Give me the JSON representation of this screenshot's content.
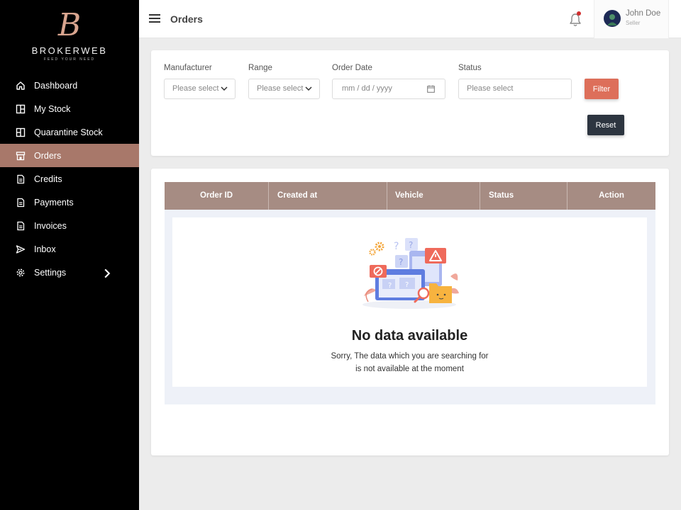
{
  "brand": {
    "mark": "B",
    "name": "BROKERWEB",
    "tagline": "FEED YOUR NEED"
  },
  "sidebar": {
    "items": [
      {
        "label": "Dashboard",
        "icon": "home-icon"
      },
      {
        "label": "My Stock",
        "icon": "stock-icon"
      },
      {
        "label": "Quarantine Stock",
        "icon": "quarantine-icon"
      },
      {
        "label": "Orders",
        "icon": "store-icon",
        "active": true
      },
      {
        "label": "Credits",
        "icon": "document-icon"
      },
      {
        "label": "Payments",
        "icon": "document-icon"
      },
      {
        "label": "Invoices",
        "icon": "document-icon"
      },
      {
        "label": "Inbox",
        "icon": "send-icon"
      },
      {
        "label": "Settings",
        "icon": "gear-icon",
        "has_submenu": true
      }
    ]
  },
  "header": {
    "title": "Orders",
    "user_name": "John Doe",
    "user_role": "Seller"
  },
  "filters": {
    "manufacturer": {
      "label": "Manufacturer",
      "placeholder": "Please select"
    },
    "range": {
      "label": "Range",
      "placeholder": "Please select"
    },
    "order_date": {
      "label": "Order Date",
      "placeholder": "mm / dd / yyyy"
    },
    "status": {
      "label": "Status",
      "placeholder": "Please select"
    },
    "filter_label": "Filter",
    "reset_label": "Reset"
  },
  "table": {
    "columns": [
      "Order ID",
      "Created at",
      "Vehicle",
      "Status",
      "Action"
    ],
    "rows": []
  },
  "empty_state": {
    "title": "No data available",
    "line1": "Sorry, The data which you are searching for",
    "line2": "is not available at the moment"
  },
  "colors": {
    "sidebar_bg": "#000000",
    "active_item": "#a8786a",
    "table_header": "#a68c83",
    "filter_button": "#dd6f5a",
    "reset_button": "#2d3540",
    "notification_dot": "#d12e2e"
  }
}
